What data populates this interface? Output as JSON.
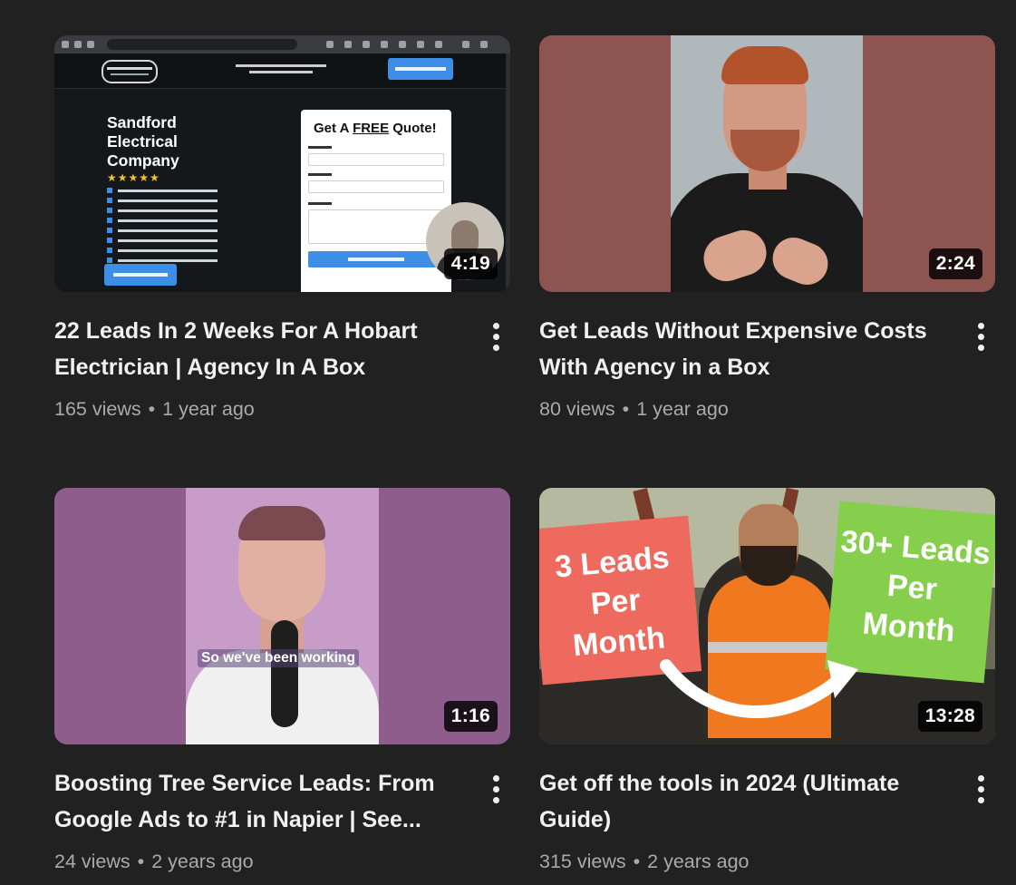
{
  "videos": [
    {
      "title": "22 Leads In 2 Weeks For A Hobart Electrician | Agency In A Box",
      "views": "165 views",
      "age": "1 year ago",
      "duration": "4:19",
      "thumb": {
        "hero_line1": "Sandford",
        "hero_line2": "Electrical",
        "hero_line3": "Company",
        "stars": "★★★★★",
        "form_title_pre": "Get A ",
        "form_title_free": "FREE",
        "form_title_post": " Quote!"
      }
    },
    {
      "title": "Get Leads Without Expensive Costs With Agency in a Box",
      "views": "80 views",
      "age": "1 year ago",
      "duration": "2:24"
    },
    {
      "title": "Boosting Tree Service Leads: From Google Ads to #1 in Napier | See...",
      "views": "24 views",
      "age": "2 years ago",
      "duration": "1:16",
      "thumb": {
        "caption": "So we've been working"
      }
    },
    {
      "title": "Get off the tools in 2024 (Ultimate Guide)",
      "views": "315 views",
      "age": "2 years ago",
      "duration": "13:28",
      "thumb": {
        "red_l1": "3 Leads",
        "red_l2": "Per",
        "red_l3": "Month",
        "green_l1": "30+ Leads",
        "green_l2": "Per",
        "green_l3": "Month"
      }
    }
  ],
  "separator": "•",
  "colors": {
    "background": "#212121",
    "title": "#f1f1f1",
    "meta": "#aaaaaa",
    "red_box": "#ee6a5f",
    "green_box": "#86cf4c"
  }
}
